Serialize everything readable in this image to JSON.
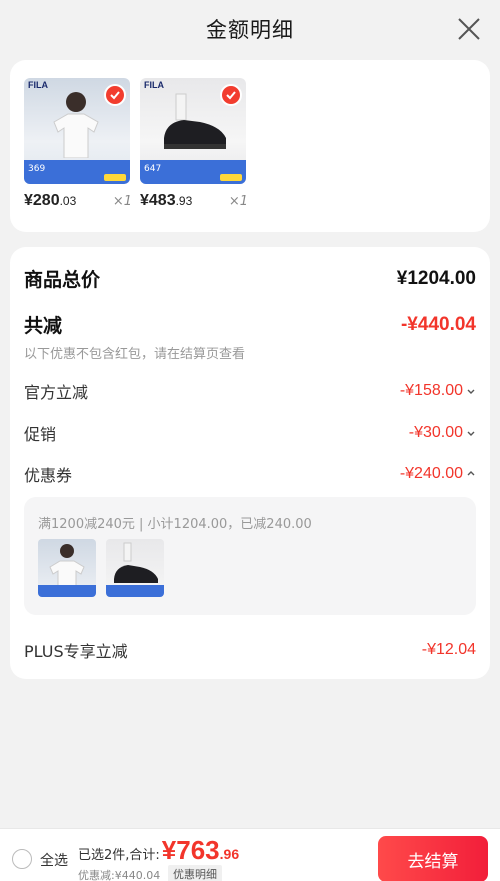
{
  "header": {
    "title": "金额明细"
  },
  "products": [
    {
      "brand": "FILA",
      "badge": "369",
      "price_int": "¥280",
      "price_dec": ".03",
      "qty": "×1"
    },
    {
      "brand": "FILA",
      "badge": "647",
      "price_int": "¥483",
      "price_dec": ".93",
      "qty": "×1"
    }
  ],
  "details": {
    "total_label": "商品总价",
    "total_value": "¥1204.00",
    "discount_label": "共减",
    "discount_value": "-¥440.04",
    "note": "以下优惠不包含红包，请在结算页查看",
    "official_label": "官方立减",
    "official_value": "-¥158.00",
    "promo_label": "促销",
    "promo_value": "-¥30.00",
    "coupon_label": "优惠券",
    "coupon_value": "-¥240.00",
    "coupon_desc": "满1200减240元 | 小计1204.00，已减240.00",
    "plus_label": "PLUS专享立减",
    "plus_value": "-¥12.04"
  },
  "bottom": {
    "select_all": "全选",
    "summary_text": "已选2件,合计:",
    "total_int": "¥763",
    "total_dec": ".96",
    "saved": "优惠减:¥440.04",
    "detail_tag": "优惠明细",
    "checkout": "去结算"
  },
  "colors": {
    "accent": "#f2352b",
    "checkout": "#f21e3a"
  }
}
